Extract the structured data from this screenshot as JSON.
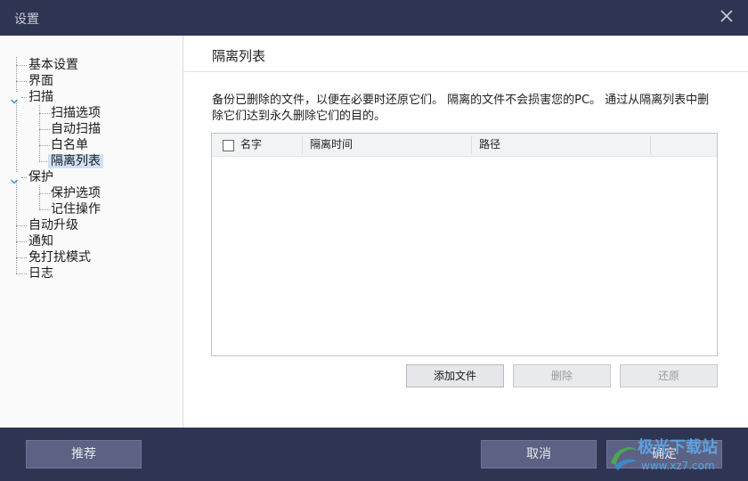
{
  "window": {
    "title": "设置"
  },
  "sidebar": {
    "items": [
      {
        "label": "基本设置"
      },
      {
        "label": "界面"
      },
      {
        "label": "扫描"
      },
      {
        "label": "扫描选项"
      },
      {
        "label": "自动扫描"
      },
      {
        "label": "白名单"
      },
      {
        "label": "隔离列表"
      },
      {
        "label": "保护"
      },
      {
        "label": "保护选项"
      },
      {
        "label": "记住操作"
      },
      {
        "label": "自动升级"
      },
      {
        "label": "通知"
      },
      {
        "label": "免打扰模式"
      },
      {
        "label": "日志"
      }
    ],
    "selected": "隔离列表"
  },
  "main": {
    "title": "隔离列表",
    "description": "备份已删除的文件，以便在必要时还原它们。 隔离的文件不会损害您的PC。 通过从隔离列表中删除它们达到永久删除它们的目的。",
    "table": {
      "columns": [
        "名字",
        "隔离时间",
        "路径"
      ],
      "rows": []
    },
    "buttons": {
      "add_file": "添加文件",
      "delete": "删除",
      "restore": "还原"
    }
  },
  "footer": {
    "recommend": "推荐",
    "cancel": "取消",
    "ok": "确定"
  },
  "watermark": {
    "line1": "极光下载站",
    "line2": "www.xz7.com"
  },
  "colors": {
    "titlebar": "#2e3553",
    "footer": "#2e3553",
    "footer_button": "#5b6283",
    "selection": "#cfe0f6"
  }
}
